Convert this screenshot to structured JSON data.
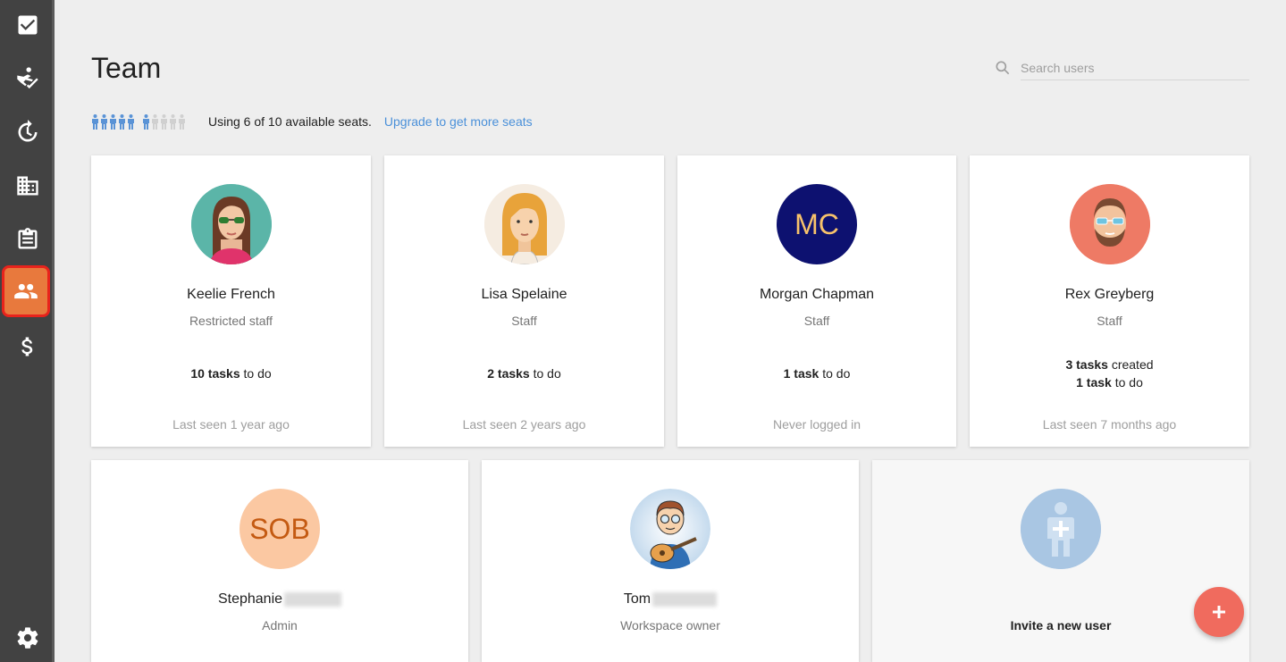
{
  "sidebar": {
    "items": [
      {
        "name": "tasks",
        "icon": "checkbox-icon"
      },
      {
        "name": "assign",
        "icon": "person-check-icon"
      },
      {
        "name": "recurring",
        "icon": "history-icon"
      },
      {
        "name": "company",
        "icon": "building-icon"
      },
      {
        "name": "reports",
        "icon": "clipboard-icon"
      },
      {
        "name": "team",
        "icon": "people-icon",
        "active": true
      },
      {
        "name": "billing",
        "icon": "dollar-icon"
      },
      {
        "name": "settings",
        "icon": "gear-icon"
      }
    ]
  },
  "header": {
    "title": "Team",
    "search_placeholder": "Search users"
  },
  "seats": {
    "used": 6,
    "total": 10,
    "text": "Using 6 of 10 available seats.",
    "upgrade_link": "Upgrade to get more seats"
  },
  "colors": {
    "accent": "#e8793d",
    "highlight_border": "#e8231c",
    "link": "#4a90d9",
    "fab": "#f06b5e"
  },
  "users": [
    {
      "name": "Keelie French",
      "role": "Restricted staff",
      "tasks_count": "10 tasks",
      "tasks_suffix": " to do",
      "last_seen": "Last seen 1 year ago"
    },
    {
      "name": "Lisa Spelaine",
      "role": "Staff",
      "tasks_count": "2 tasks",
      "tasks_suffix": " to do",
      "last_seen": "Last seen 2 years ago"
    },
    {
      "name": "Morgan Chapman",
      "initials": "MC",
      "role": "Staff",
      "tasks_count": "1 task",
      "tasks_suffix": " to do",
      "last_seen": "Never logged in"
    },
    {
      "name": "Rex Greyberg",
      "role": "Staff",
      "created_count": "3 tasks",
      "created_suffix": " created",
      "tasks_count": "1 task",
      "tasks_suffix": " to do",
      "last_seen": "Last seen 7 months ago"
    },
    {
      "name": "Stephanie",
      "initials": "SOB",
      "role": "Admin"
    },
    {
      "name": "Tom",
      "role": "Workspace owner"
    }
  ],
  "invite": {
    "label": "Invite a new user"
  }
}
